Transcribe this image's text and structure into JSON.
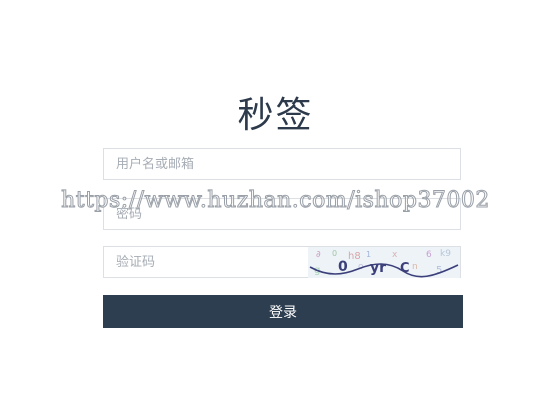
{
  "app": {
    "title": "秒签"
  },
  "form": {
    "username_placeholder": "用户名或邮箱",
    "password_placeholder": "密码",
    "captcha_placeholder": "验证码",
    "captcha_image_text": "0 hx kg 5 np C",
    "login_label": "登录"
  },
  "watermark": {
    "text": "https://www.huzhan.com/ishop37002"
  },
  "colors": {
    "title": "#2c3a4b",
    "button_bg": "#2d3e50",
    "button_text": "#ffffff",
    "input_border": "#dcdfe3",
    "placeholder": "#a7adb5"
  }
}
